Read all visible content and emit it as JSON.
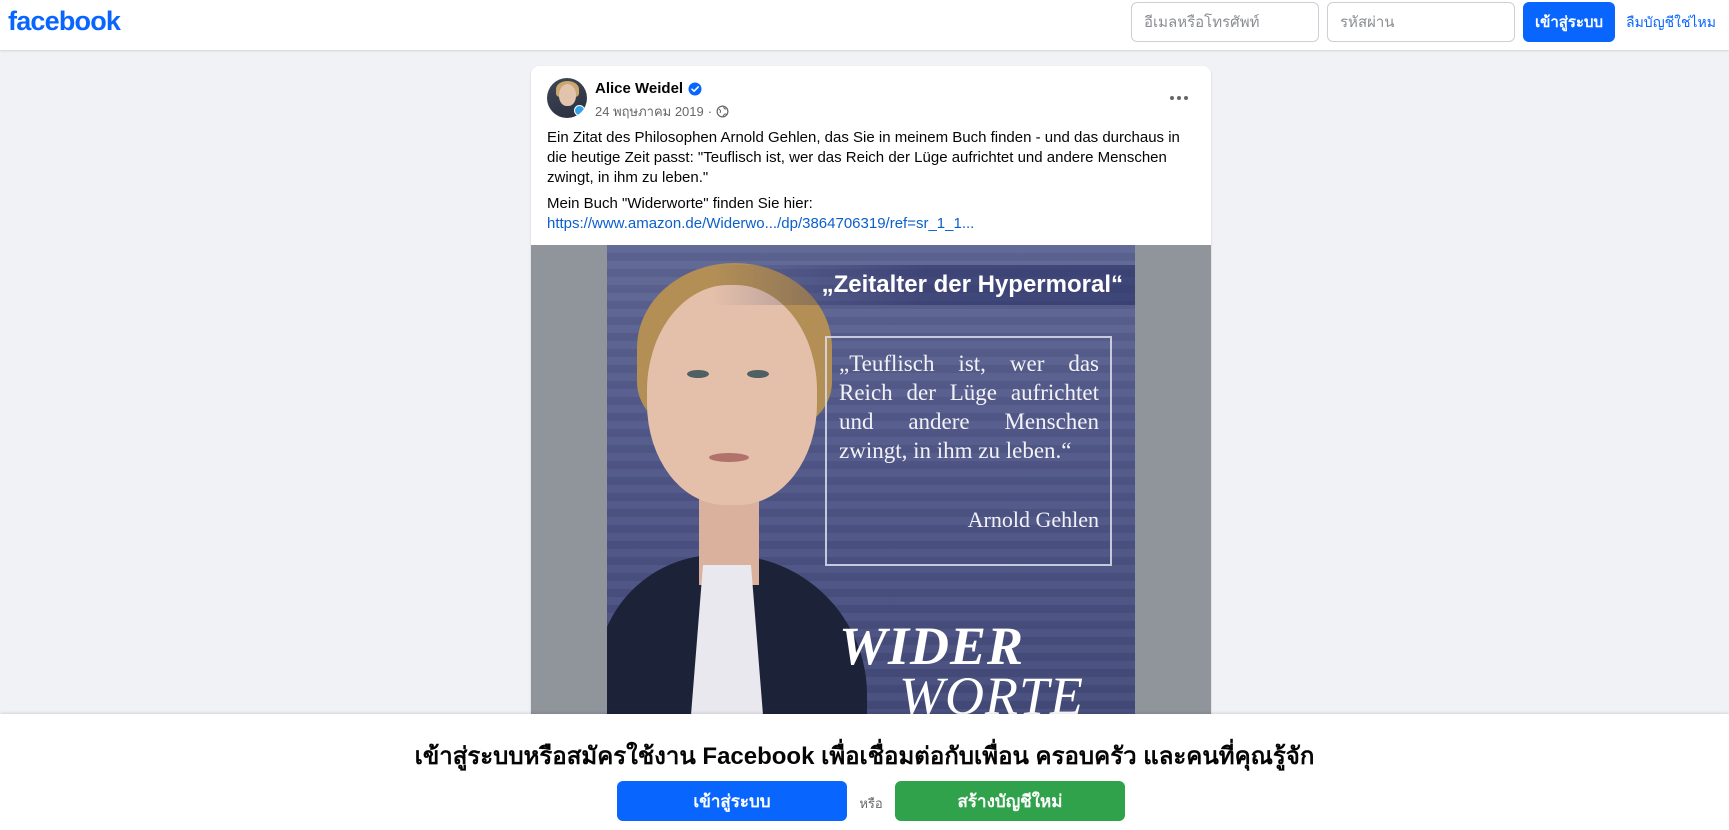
{
  "header": {
    "logo_text": "facebook",
    "email_placeholder": "อีเมลหรือโทรศัพท์",
    "password_placeholder": "รหัสผ่าน",
    "login_label": "เข้าสู่ระบบ",
    "forgot_label": "ลืมบัญชีใช่ไหม"
  },
  "post": {
    "author": "Alice Weidel",
    "date": "24 พฤษภาคม 2019",
    "separator": "·",
    "paragraph_1": "Ein Zitat des Philosophen Arnold Gehlen, das Sie in meinem Buch finden - und das durchaus in die heutige Zeit passt: \"Teuflisch ist, wer das Reich der Lüge aufrichtet und andere Menschen zwingt, in ihm zu leben.\"",
    "paragraph_2": "Mein Buch \"Widerworte\" finden Sie hier:",
    "link": "https://www.amazon.de/Widerwo.../dp/3864706319/ref=sr_1_1...",
    "image": {
      "banner": "„Zeitalter der Hypermoral“",
      "quote": "„Teuflisch ist, wer das Reich der Lüge aufrichtet und andere Menschen zwingt, in ihm zu leben.“",
      "quote_author": "Arnold Gehlen",
      "title_line_1": "WIDER",
      "title_line_2": "WORTE"
    }
  },
  "bottom_banner": {
    "title": "เข้าสู่ระบบหรือสมัครใช้งาน Facebook เพื่อเชื่อมต่อกับเพื่อน ครอบครัว และคนที่คุณรู้จัก",
    "login_label": "เข้าสู่ระบบ",
    "or_label": "หรือ",
    "create_label": "สร้างบัญชีใหม่"
  },
  "icons": {
    "verified": "verified-badge-icon",
    "audience": "globe-icon",
    "more": "more-options-icon"
  },
  "colors": {
    "brand_blue": "#0866ff",
    "create_green": "#31a24c",
    "background": "#f0f2f5",
    "link": "#0b5fcc"
  }
}
